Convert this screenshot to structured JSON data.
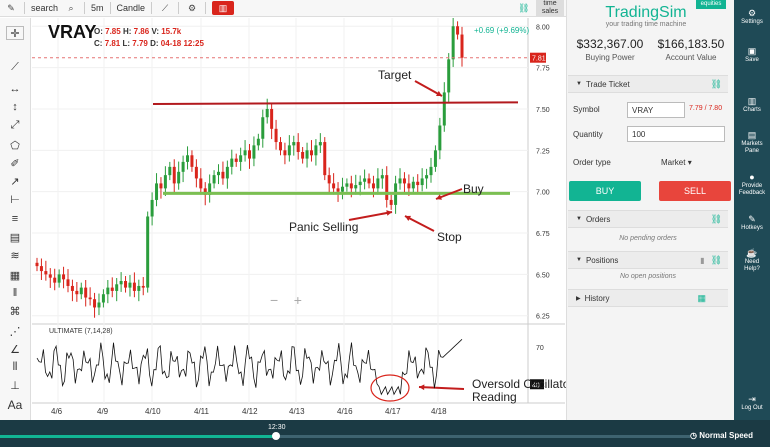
{
  "toolbar": {
    "search_label": "search",
    "interval": "5m",
    "chart_type": "Candle",
    "time_sales_line1": "time",
    "time_sales_line2": "sales"
  },
  "chart": {
    "ticker": "VRAY",
    "ohlc": {
      "o_label": "O:",
      "o_value": "7.85",
      "h_label": "H:",
      "h_value": "7.86",
      "v_label": "V:",
      "v_value": "15.7k",
      "c_label": "C:",
      "c_value": "7.81",
      "l_label": "L:",
      "l_value": "7.79",
      "d_label": "D:",
      "d_value": "04-18 12:25"
    },
    "change": "+0.69 (+9.69%)",
    "price_tag": "7.81",
    "y_ticks": [
      "8.00",
      "7.75",
      "7.50",
      "7.25",
      "7.00",
      "6.75",
      "6.50",
      "6.25"
    ],
    "x_ticks": [
      "4/6",
      "4/9",
      "4/10",
      "4/11",
      "4/12",
      "4/13",
      "4/16",
      "4/17",
      "4/18"
    ],
    "osc_label": "ULTIMATE (7,14,28)",
    "osc_ticks": [
      "70",
      "40"
    ],
    "annotations": {
      "target": "Target",
      "buy": "Buy",
      "panic": "Panic Selling",
      "stop": "Stop",
      "oversold1": "Oversold Oscillator",
      "oversold2": "Reading"
    },
    "zoom_minus": "−",
    "zoom_plus": "+",
    "chart_data": {
      "type": "candlestick",
      "ylim": [
        6.2,
        8.05
      ],
      "series_close": [
        6.55,
        6.52,
        6.5,
        6.48,
        6.45,
        6.5,
        6.47,
        6.43,
        6.4,
        6.38,
        6.42,
        6.36,
        6.35,
        6.3,
        6.33,
        6.38,
        6.42,
        6.4,
        6.44,
        6.46,
        6.42,
        6.45,
        6.4,
        6.43,
        6.42,
        6.85,
        6.95,
        7.05,
        7.02,
        7.1,
        7.15,
        7.05,
        7.12,
        7.18,
        7.22,
        7.15,
        7.08,
        7.02,
        6.98,
        7.05,
        7.1,
        7.12,
        7.08,
        7.15,
        7.2,
        7.18,
        7.22,
        7.25,
        7.2,
        7.28,
        7.32,
        7.45,
        7.5,
        7.38,
        7.3,
        7.25,
        7.22,
        7.28,
        7.3,
        7.24,
        7.2,
        7.25,
        7.22,
        7.28,
        7.3,
        7.1,
        7.05,
        7.02,
        7.0,
        7.03,
        7.05,
        7.02,
        7.04,
        7.06,
        7.08,
        7.05,
        7.02,
        7.08,
        7.1,
        6.95,
        6.92,
        7.05,
        7.08,
        7.05,
        7.02,
        7.06,
        7.04,
        7.08,
        7.1,
        7.15,
        7.25,
        7.4,
        7.6,
        7.8,
        8.0,
        7.95,
        7.81
      ]
    }
  },
  "panel": {
    "brand": "TradingSim",
    "badge": "equities",
    "tagline": "your trading time machine",
    "buying_power": "$332,367.00",
    "buying_power_label": "Buying Power",
    "account_value": "$166,183.50",
    "account_value_label": "Account Value",
    "trade_ticket": "Trade Ticket",
    "symbol_label": "Symbol",
    "symbol_value": "VRAY",
    "bid_ask": "7.79 / 7.80",
    "quantity_label": "Quantity",
    "quantity_value": "100",
    "order_type_label": "Order type",
    "order_type_value": "Market",
    "buy": "BUY",
    "sell": "SELL",
    "orders": "Orders",
    "no_orders": "No pending orders",
    "positions": "Positions",
    "no_positions": "No open positions",
    "history": "History"
  },
  "nav": {
    "settings": "Settings",
    "save": "Save",
    "charts": "Charts",
    "markets1": "Markets",
    "markets2": "Pane",
    "feedback1": "Provide",
    "feedback2": "Feedback",
    "hotkeys": "Hotkeys",
    "help1": "Need",
    "help2": "Help?",
    "logout": "Log Out"
  },
  "playback": {
    "time": "12:30",
    "progress": 0.4,
    "speed": "Normal Speed"
  },
  "colors": {
    "accent": "#12b493",
    "sell": "#e8453c",
    "nav_bg": "#1f4a56",
    "up": "#2a9d3c",
    "down": "#d9251c"
  }
}
